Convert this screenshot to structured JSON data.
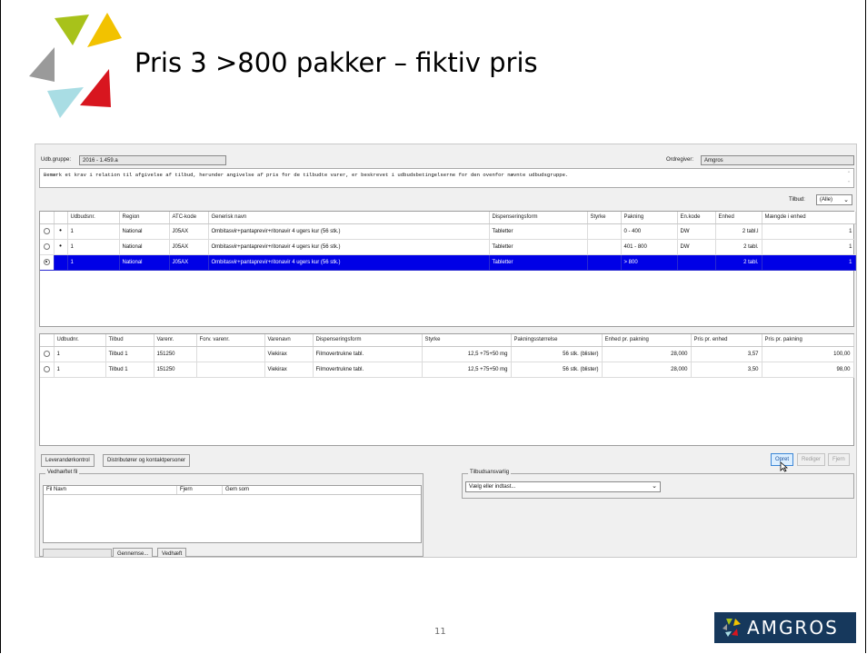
{
  "slide": {
    "title": "Pris 3 >800 pakker – fiktiv pris",
    "page_number": "11",
    "brand": "AMGROS"
  },
  "header": {
    "udb_label": "Udb.gruppe:",
    "udb_value": "2016 - 1.459.a",
    "ordregiver_label": "Ordregiver:",
    "ordregiver_value": "Amgros"
  },
  "note": "Bemærk et krav i relation til afgivelse af tilbud, herunder angivelse af pris for de tilbudte varer, er beskrevet i udbudsbetingelserne for den ovenfor nævnte udbudsgruppe.",
  "filter": {
    "label": "Tilbud:",
    "value": "(Alle)"
  },
  "top_table": {
    "columns": [
      "",
      "",
      "Udbudsnr.",
      "Region",
      "ATC-kode",
      "Generisk navn",
      "Dispenseringsform",
      "Styrke",
      "Pakning",
      "En.kode",
      "Enhed",
      "Mængde i enhed"
    ],
    "rows": [
      {
        "radio": "",
        "dot": "•",
        "udbudsnr": "1",
        "region": "National",
        "atc": "J05AX",
        "generisk": "Ombitasvir+pantaprevir+ritonavir 4 ugers kur (56 stk.)",
        "disp": "Tabletter",
        "styrke": "",
        "pakning": "0 - 400",
        "enkode": "DW",
        "enhed": "2 tabl.l",
        "maengde": "1"
      },
      {
        "radio": "",
        "dot": "•",
        "udbudsnr": "1",
        "region": "National",
        "atc": "J05AX",
        "generisk": "Ombitasvir+pantaprevir+ritonavir 4 ugers kur (56 stk.)",
        "disp": "Tabletter",
        "styrke": "",
        "pakning": "401 - 800",
        "enkode": "DW",
        "enhed": "2 tabl.",
        "maengde": "1"
      },
      {
        "radio": "",
        "dot": "",
        "udbudsnr": "1",
        "region": "National",
        "atc": "J05AX",
        "generisk": "Ombitasvir+pantaprevir+ritonavir 4 ugers kur (56 stk.)",
        "disp": "Tabletter",
        "styrke": "",
        "pakning": "> 800",
        "enkode": "",
        "enhed": "2 tabl.",
        "maengde": "1"
      }
    ]
  },
  "bottom_table": {
    "columns": [
      "",
      "Udbudnr.",
      "Tilbud",
      "Varenr.",
      "Forv. varenr.",
      "Varenavn",
      "Dispenseringsform",
      "Styrke",
      "Pakningsstørrelse",
      "Enhed pr. pakning",
      "Pris pr. enhed",
      "Pris pr. pakning"
    ],
    "rows": [
      {
        "udbudnr": "1",
        "tilbud": "Tilbud 1",
        "varenr": "151250",
        "forv": "",
        "varenavn": "Viekirax",
        "disp": "Filmovertrukne tabl.",
        "styrke": "12,5 +75+50 mg",
        "pakning": "56 stk. (blister)",
        "enhed_pr": "28,000",
        "pris_enhed": "3,57",
        "pris_pakning": "100,00"
      },
      {
        "udbudnr": "1",
        "tilbud": "Tilbud 1",
        "varenr": "151250",
        "forv": "",
        "varenavn": "Viekirax",
        "disp": "Filmovertrukne tabl.",
        "styrke": "12,5 +75+50 mg",
        "pakning": "56 stk. (blister)",
        "enhed_pr": "28,000",
        "pris_enhed": "3,50",
        "pris_pakning": "98,00"
      }
    ]
  },
  "buttons": {
    "leverandor": "Leverandørkontrol",
    "distributorer": "Distributører og kontaktpersoner",
    "opret": "Opret",
    "rediger": "Rediger",
    "fjern": "Fjern",
    "gennemse": "Gennemse...",
    "vedhaeft": "Vedhæft"
  },
  "attach": {
    "group_title": "Vedhæftet fil",
    "col_filnavn": "Fil Navn",
    "col_fjern": "Fjern",
    "col_gem": "Gem som"
  },
  "tilbudsansvarlig": {
    "group_title": "Tilbudsansvarlig",
    "placeholder": "Vælg eller indtast..."
  },
  "colors": {
    "selection": "#0000e6",
    "brand_navy": "#16385c",
    "logo_green": "#a8c21a",
    "logo_yellow": "#f2c200",
    "logo_gray": "#9a9a9a",
    "logo_cyan": "#a9dde4",
    "logo_red": "#d8161f"
  }
}
